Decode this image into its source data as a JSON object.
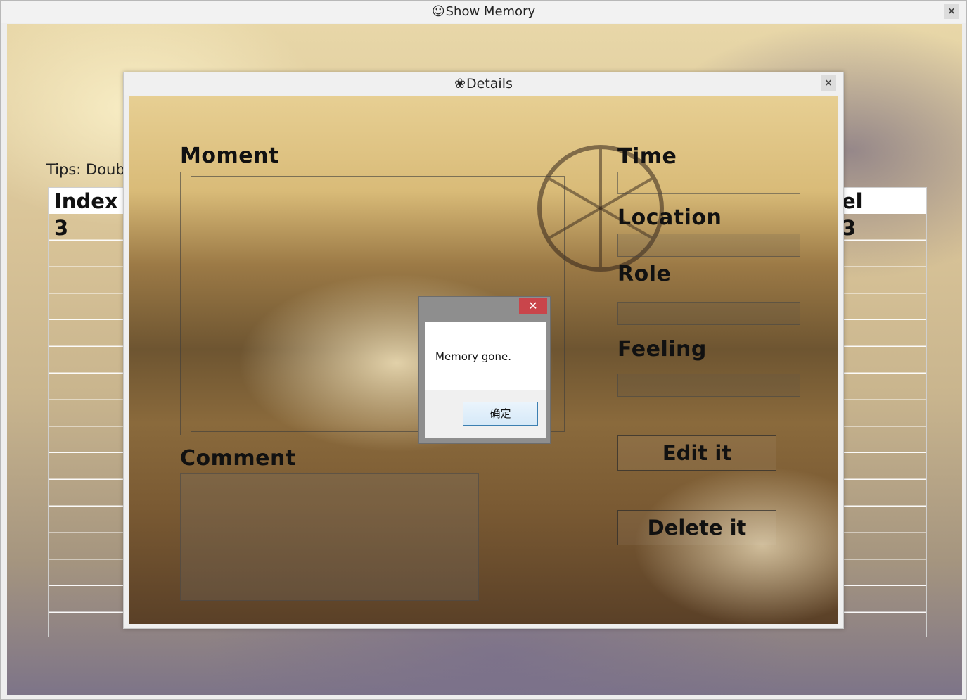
{
  "main_window": {
    "title_glyph": "☺",
    "title": "Show Memory",
    "close_glyph": "×",
    "tips": "Tips: Doub",
    "table": {
      "header_visible": [
        "Index",
        "el"
      ],
      "row_visible": [
        "3",
        "3"
      ]
    }
  },
  "details_window": {
    "title_glyph": "❀",
    "title": "Details",
    "close_glyph": "×",
    "labels": {
      "moment": "Moment",
      "time": "Time",
      "location": "Location",
      "role": "Role",
      "feeling": "Feeling",
      "comment": "Comment"
    },
    "buttons": {
      "edit": "Edit it",
      "delete": "Delete it"
    }
  },
  "message_box": {
    "close_glyph": "✕",
    "message": "Memory gone.",
    "ok_label": "确定"
  }
}
